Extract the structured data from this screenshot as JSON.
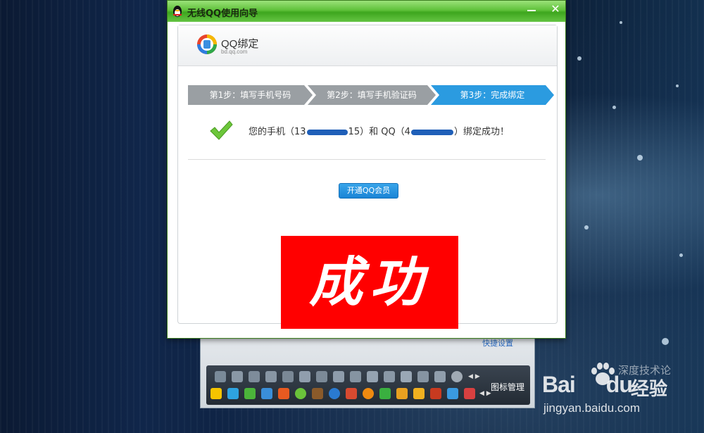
{
  "window": {
    "title": "无线QQ使用向导",
    "minimize_label": "—",
    "close_label": "✕"
  },
  "brand": {
    "name": "QQ绑定",
    "domain": "bd.qq.com"
  },
  "steps": [
    {
      "label": "第1步：填写手机号码",
      "state": "done"
    },
    {
      "label": "第2步：填写手机验证码",
      "state": "done"
    },
    {
      "label": "第3步：完成绑定",
      "state": "active"
    }
  ],
  "success": {
    "text_prefix": "您的手机（13",
    "text_mid1": "15）和 QQ（4",
    "text_suffix": "）绑定成功！"
  },
  "vip_button_label": "开通QQ会员",
  "stamp_text": "成功",
  "background_window": {
    "link_text": "快捷设置",
    "tray_label": "图标管理"
  },
  "watermark": {
    "logo_text": "Bai",
    "logo_text2": "du",
    "jingyan": "经验",
    "url": "jingyan.baidu.com",
    "deep": "深度技术论"
  },
  "colors": {
    "titlebar_green": "#4db52a",
    "step_inactive": "#9a9fa3",
    "step_active": "#2b9be0",
    "stamp_red": "#ff0000",
    "button_blue": "#1a84d6"
  }
}
